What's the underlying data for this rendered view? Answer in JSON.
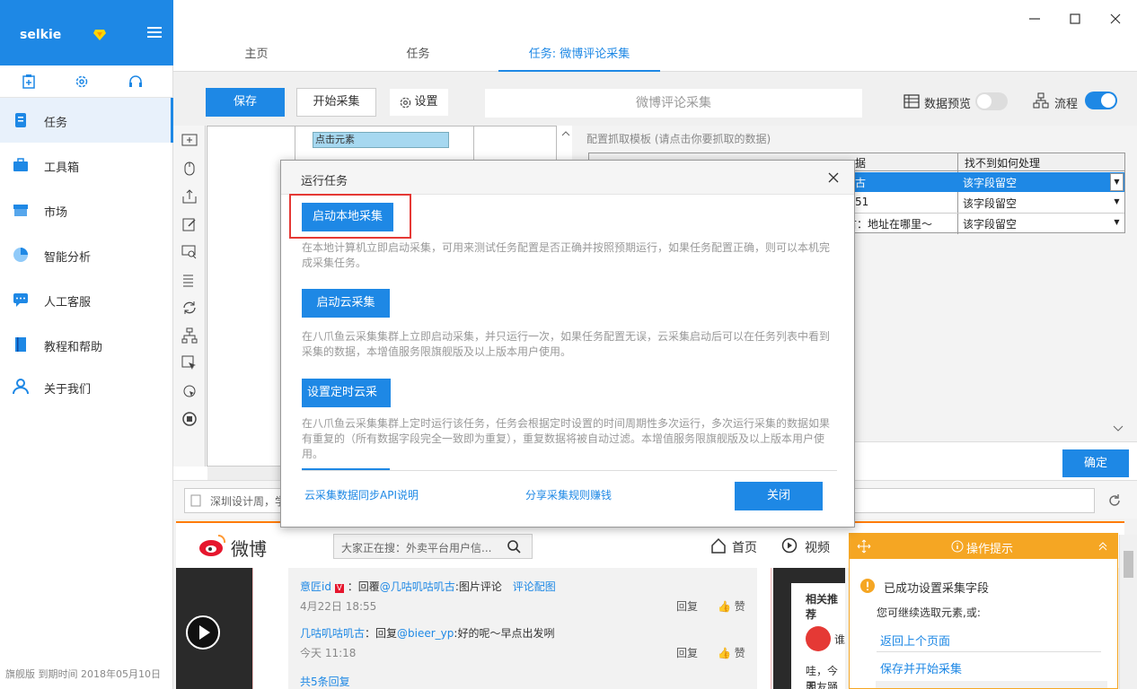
{
  "sidebar": {
    "user": "selkie",
    "items": [
      {
        "label": "任务",
        "icon": "task-icon",
        "active": true
      },
      {
        "label": "工具箱",
        "icon": "toolbox-icon"
      },
      {
        "label": "市场",
        "icon": "market-icon"
      },
      {
        "label": "智能分析",
        "icon": "pie-chart-icon"
      },
      {
        "label": "人工客服",
        "icon": "chat-icon"
      },
      {
        "label": "教程和帮助",
        "icon": "book-icon"
      },
      {
        "label": "关于我们",
        "icon": "person-icon"
      }
    ],
    "footer": "旗舰版  到期时间  2018年05月10日"
  },
  "tabs": [
    {
      "label": "主页"
    },
    {
      "label": "任务"
    },
    {
      "label": "任务: 微博评论采集",
      "active": true
    }
  ],
  "toolbar": {
    "save": "保存",
    "start": "开始采集",
    "settings": "设置",
    "title": "微博评论采集",
    "preview": "数据预览",
    "flow": "流程"
  },
  "flow": {
    "node": "点击元素"
  },
  "grid": {
    "hint": "配置抓取模板 (请点击你要抓取的数据)",
    "header_partial": "据",
    "col_missing": "找不到如何处理",
    "rows": [
      {
        "partial": "古",
        "value": "该字段留空"
      },
      {
        "partial": "51",
        "value": "该字段留空"
      },
      {
        "partial": "古：地址在哪里～",
        "value": "该字段留空"
      }
    ],
    "confirm": "确定"
  },
  "browser": {
    "url_partial": "深圳设计周，学"
  },
  "weibo": {
    "logo": "微博",
    "search_placeholder": "大家正在搜：外卖平台用户信...",
    "nav_home": "首页",
    "nav_video": "视频",
    "side_title": "相关推荐",
    "side_text_1": "哇，今天",
    "side_text_2": "朋友踊跃",
    "side_text_3": "谁",
    "comments": [
      {
        "user": "意匠id",
        "prefix": "：回覆",
        "mention": "@几咕叽咕叽古",
        "text": ":图片评论",
        "extra": "评论配图",
        "time": "4月22日 18:55"
      },
      {
        "user": "几咕叽咕叽古",
        "prefix": "：回复",
        "mention": "@bieer_yp",
        "text": ":好的呢～早点出发咧",
        "extra": "",
        "time": "今天 11:18"
      }
    ],
    "reply": "回复",
    "like": "赞",
    "more": "共5条回复"
  },
  "dialog": {
    "title": "运行任务",
    "local_btn": "启动本地采集",
    "local_desc": "在本地计算机立即启动采集，可用来测试任务配置是否正确并按照预期运行，如果任务配置正确，则可以本机完成采集任务。",
    "cloud_btn": "启动云采集",
    "cloud_desc": "在八爪鱼云采集集群上立即启动采集，并只运行一次，如果任务配置无误，云采集启动后可以在任务列表中看到采集的数据，本增值服务限旗舰版及以上版本用户使用。",
    "timer_btn": "设置定时云采集",
    "timer_desc": "在八爪鱼云采集集群上定时运行该任务，任务会根据定时设置的时间周期性多次运行，多次运行采集的数据如果有重复的（所有数据字段完全一致即为重复），重复数据将被自动过滤。本增值服务限旗舰版及以上版本用户使用。",
    "api_link": "云采集数据同步API说明",
    "share_link": "分享采集规则赚钱",
    "close": "关闭"
  },
  "tip": {
    "title": "操作提示",
    "message": "已成功设置采集字段",
    "sub": "您可继续选取元素,或:",
    "back": "返回上个页面",
    "save_start": "保存并开始采集"
  },
  "colors": {
    "accent": "#1e88e5",
    "warning": "#f5a623",
    "highlight": "#e53935"
  }
}
